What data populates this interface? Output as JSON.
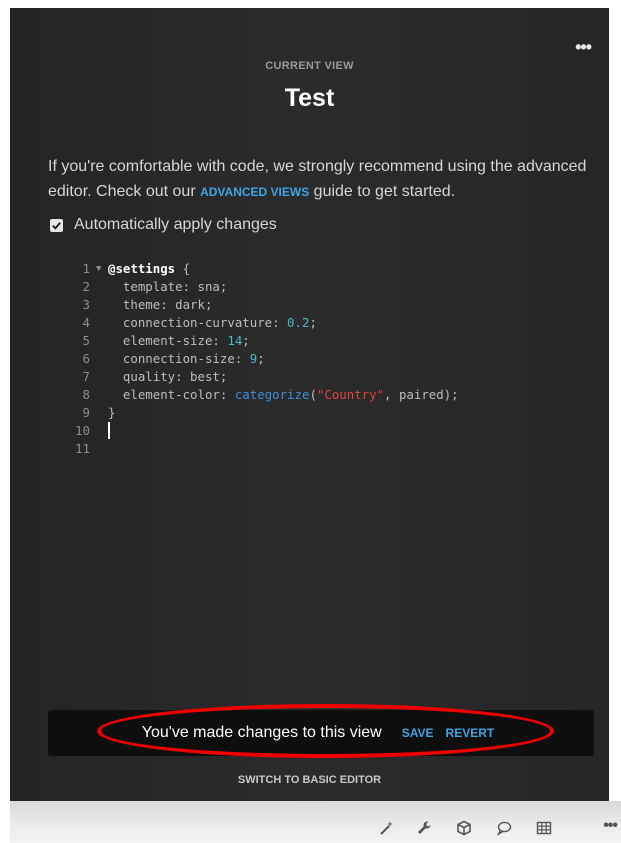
{
  "panel": {
    "more_label": "•••",
    "caption": "CURRENT VIEW",
    "title": "Test",
    "intro_before": "If you're comfortable with code, we strongly recommend using the advanced editor. Check out our ",
    "intro_link": "ADVANCED VIEWS",
    "intro_after": " guide to get started.",
    "auto_apply_label": "Automatically apply changes",
    "auto_apply_checked": true
  },
  "code": {
    "line_numbers": [
      "1",
      "2",
      "3",
      "4",
      "5",
      "6",
      "7",
      "8",
      "9",
      "10",
      "11"
    ],
    "l1_kw": "@settings",
    "l1_rest": " {",
    "l2": "  template: sna;",
    "l3": "  theme: dark;",
    "l4_a": "  connection-curvature: ",
    "l4_num": "0.2",
    "l4_b": ";",
    "l5_a": "  element-size: ",
    "l5_num": "14",
    "l5_b": ";",
    "l6_a": "  connection-size: ",
    "l6_num": "9",
    "l6_b": ";",
    "l7": "  quality: best;",
    "l8_a": "  element-color: ",
    "l8_fn": "categorize",
    "l8_b": "(",
    "l8_str": "\"Country\"",
    "l8_c": ", paired);",
    "l9": "}"
  },
  "notice": {
    "message": "You've made changes to this view",
    "save": "SAVE",
    "revert": "REVERT"
  },
  "switch_label": "SWITCH TO BASIC EDITOR",
  "toolbar": {
    "icons": [
      "magic-wand-icon",
      "wrench-icon",
      "cube-icon",
      "comment-icon",
      "table-icon",
      "more-icon"
    ],
    "more_label": "•••"
  },
  "colors": {
    "accent": "#3ea6e6",
    "highlight": "#ee0000",
    "panel_bg": "#262626"
  }
}
